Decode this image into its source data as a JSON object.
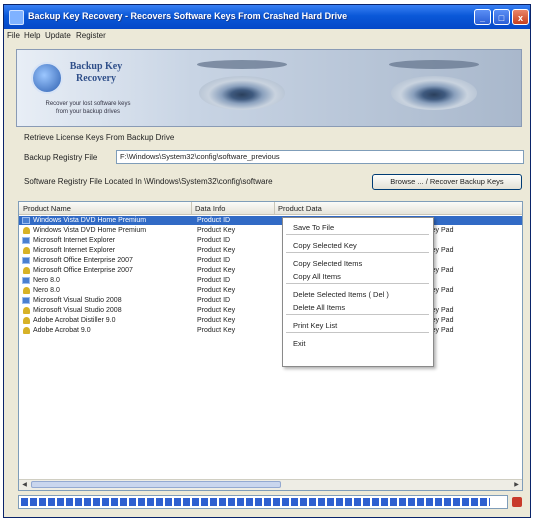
{
  "window": {
    "title": "Backup Key Recovery - Recovers Software Keys From Crashed Hard Drive",
    "buttons": [
      "_",
      "□",
      "x"
    ]
  },
  "menubar": [
    "File",
    "Help",
    "Update",
    "Register"
  ],
  "banner": {
    "logo_line1": "Backup Key",
    "logo_line2": "Recovery",
    "tagline": "Recover your lost software keys from your backup drives"
  },
  "form": {
    "section_label": "Retrieve License Keys From Backup Drive",
    "registry_label": "Backup Registry File",
    "registry_path": "F:\\Windows\\System32\\config\\software_previous",
    "located_label": "Software Registry File Located In \\Windows\\System32\\config\\software",
    "browse_button": "Browse ... / Recover Backup Keys"
  },
  "grid": {
    "columns": [
      "Product Name",
      "Data Info",
      "Product Data"
    ],
    "rows": [
      {
        "icon": "windows-icon",
        "name": "Windows Vista DVD Home Premium",
        "info": "Product ID",
        "data": "",
        "selected": true
      },
      {
        "icon": "key-icon",
        "name": "Windows Vista DVD Home Premium",
        "info": "Product Key",
        "data": "Key Pad",
        "selected": false
      },
      {
        "icon": "windows-icon",
        "name": "Microsoft Internet Explorer",
        "info": "Product ID",
        "data": "",
        "selected": false
      },
      {
        "icon": "key-icon",
        "name": "Microsoft Internet Explorer",
        "info": "Product Key",
        "data": "Key Pad",
        "selected": false
      },
      {
        "icon": "windows-icon",
        "name": "Microsoft Office Enterprise 2007",
        "info": "Product ID",
        "data": "",
        "selected": false
      },
      {
        "icon": "key-icon",
        "name": "Microsoft Office Enterprise 2007",
        "info": "Product Key",
        "data": "Key Pad",
        "selected": false
      },
      {
        "icon": "windows-icon",
        "name": "Nero 8.0",
        "info": "Product ID",
        "data": "",
        "selected": false
      },
      {
        "icon": "key-icon",
        "name": "Nero 8.0",
        "info": "Product Key",
        "data": "Key Pad",
        "selected": false
      },
      {
        "icon": "windows-icon",
        "name": "Microsoft Visual Studio 2008",
        "info": "Product ID",
        "data": "",
        "selected": false
      },
      {
        "icon": "key-icon",
        "name": "Microsoft Visual Studio 2008",
        "info": "Product Key",
        "data": "Key Pad",
        "selected": false
      },
      {
        "icon": "key-icon",
        "name": "Adobe Acrobat Distiller 9.0",
        "info": "Product Key",
        "data": "Key Pad",
        "selected": false
      },
      {
        "icon": "key-icon",
        "name": "Adobe Acrobat 9.0",
        "info": "Product Key",
        "data": "Key Pad",
        "selected": false
      }
    ]
  },
  "context_menu": {
    "items": [
      {
        "label": "Save To File",
        "sep_after": true
      },
      {
        "label": "Copy Selected Key",
        "sep_after": true
      },
      {
        "label": "Copy Selected Items",
        "sep_after": false
      },
      {
        "label": "Copy All Items",
        "sep_after": true
      },
      {
        "label": "Delete Selected Items ( Del )",
        "sep_after": false
      },
      {
        "label": "Delete All Items",
        "sep_after": true
      },
      {
        "label": "Print Key List",
        "sep_after": true
      },
      {
        "label": "Exit",
        "sep_after": false
      }
    ]
  },
  "progress": {
    "fraction": 0.97
  },
  "colors": {
    "titlebar": "#0a58d8",
    "selection": "#316ac5",
    "progress": "#2d5fd0"
  }
}
